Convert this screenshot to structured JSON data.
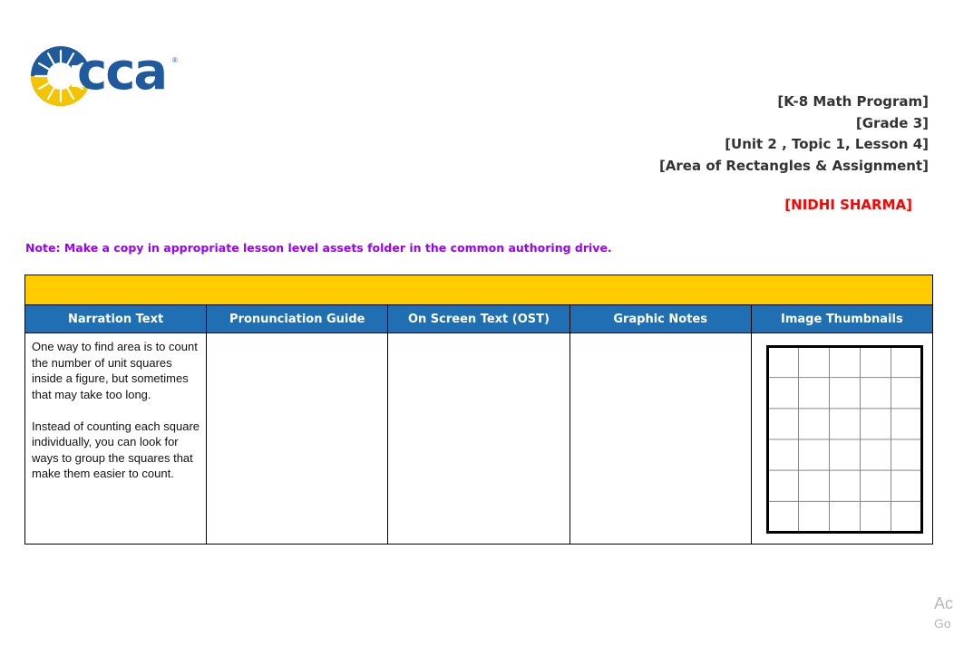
{
  "logo": {
    "text": "cca",
    "registered_mark": "®"
  },
  "header": {
    "lines": [
      "[K-8 Math Program]",
      "[Grade 3]",
      "[Unit 2 , Topic 1, Lesson 4]",
      "[Area of Rectangles & Assignment]"
    ],
    "author": "[NIDHI SHARMA]"
  },
  "note": "Note: Make a copy in appropriate lesson level assets folder in the common authoring drive.",
  "table": {
    "columns": [
      "Narration Text",
      "Pronunciation Guide",
      "On Screen Text (OST)",
      "Graphic Notes",
      "Image Thumbnails"
    ],
    "row": {
      "narration": [
        "One way to find area is to count the number of unit squares inside a figure, but sometimes that may take too long.",
        "Instead of counting each square individually, you can look for ways to group the squares that make them easier to count."
      ],
      "pronunciation": "",
      "ost": "",
      "graphic_notes": "",
      "thumbnail": {
        "grid_columns": 5,
        "grid_rows": 6
      }
    }
  },
  "watermark": {
    "line1": "Ac",
    "line2": "Go"
  },
  "colors": {
    "brand_blue": "#1f5a9e",
    "header_blue": "#1f6fb2",
    "bar_yellow": "#ffcc00",
    "author_red": "#ff0000",
    "note_purple": "#9900ff"
  }
}
